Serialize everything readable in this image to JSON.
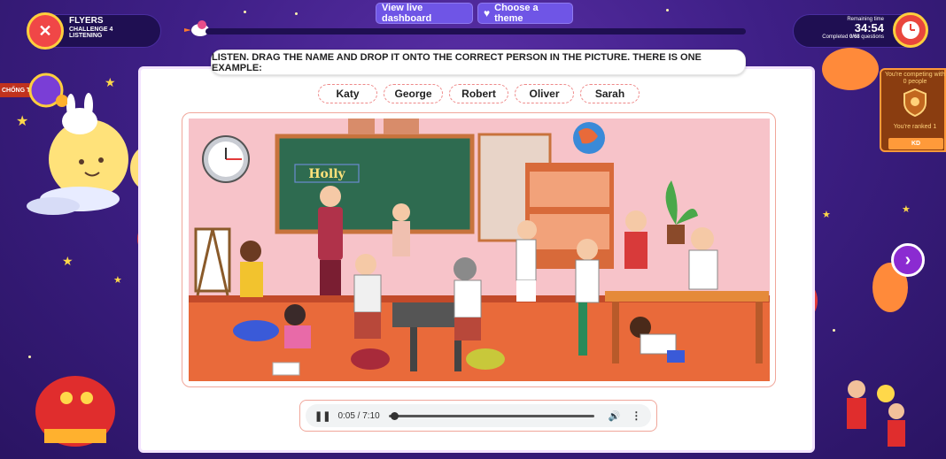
{
  "header": {
    "challenge_title": "FLYERS",
    "challenge_sub1": "CHALLENGE 4",
    "challenge_sub2": "LISTENING",
    "btn_dashboard": "View live dashboard",
    "btn_theme": "Choose a theme",
    "progress_fraction": 0.0
  },
  "timer": {
    "label": "Remaining time",
    "value": "34:54",
    "completed_prefix": "Completed ",
    "completed_count": "0/68",
    "completed_suffix": " questions"
  },
  "question": {
    "instruction": "LISTEN. DRAG THE NAME AND DROP IT ONTO THE CORRECT PERSON IN THE PICTURE. THERE IS ONE EXAMPLE:",
    "names": [
      "Katy",
      "George",
      "Robert",
      "Oliver",
      "Sarah"
    ],
    "example_label": "Holly"
  },
  "audio": {
    "time": "0:05 / 7:10",
    "progress_fraction": 0.012
  },
  "competition": {
    "competing": "You're competing with 0 people",
    "ranked": "You're ranked 1",
    "initials": "KD"
  },
  "left_tag": "CHỐNG T"
}
